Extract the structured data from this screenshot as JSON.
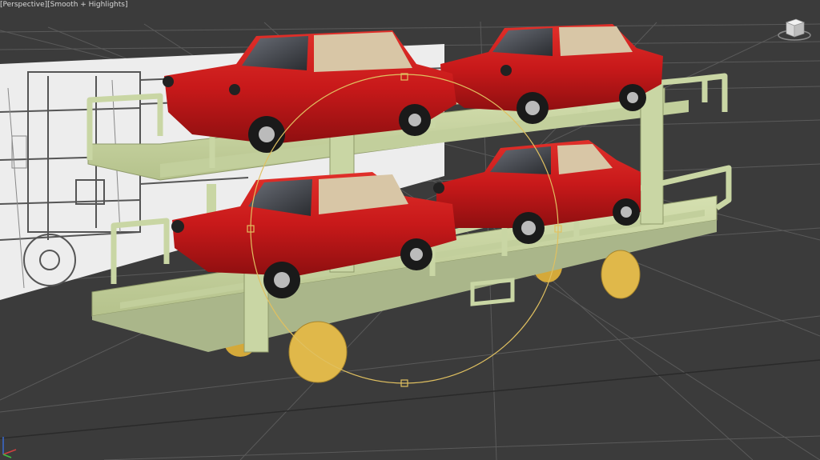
{
  "viewport": {
    "label_bracket_open": "[",
    "label_view": "Perspective",
    "label_separator": "][",
    "label_shading": "Smooth + Highlights",
    "label_bracket_close": "]"
  },
  "scene": {
    "objects": [
      {
        "name": "car-top-left",
        "type": "car",
        "color": "#c8191a"
      },
      {
        "name": "car-top-right",
        "type": "car",
        "color": "#c8191a"
      },
      {
        "name": "car-bottom-left",
        "type": "car",
        "color": "#c8191a"
      },
      {
        "name": "car-bottom-right",
        "type": "car",
        "color": "#c8191a"
      },
      {
        "name": "wagon-frame",
        "type": "railcar",
        "color": "#c9d6a4"
      },
      {
        "name": "wheels",
        "type": "wheel",
        "color": "#e0b84a"
      },
      {
        "name": "reference-blueprint",
        "type": "image-plane",
        "color": "#e8e8e8"
      },
      {
        "name": "rotate-gizmo",
        "type": "transform-gizmo",
        "color": "#e0c060"
      }
    ],
    "background_color": "#3b3b3b",
    "grid_color": "#5a5a5a"
  },
  "viewcube": {
    "icon": "viewcube-icon"
  },
  "axis": {
    "icon": "axis-tripod-icon"
  }
}
